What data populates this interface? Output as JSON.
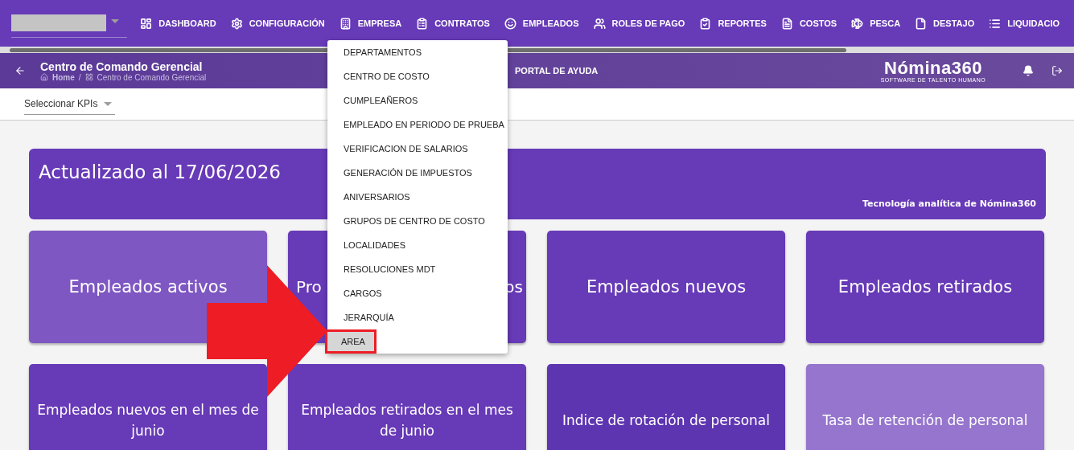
{
  "nav": {
    "items": [
      "DASHBOARD",
      "CONFIGURACIÓN",
      "EMPRESA",
      "CONTRATOS",
      "EMPLEADOS",
      "ROLES DE PAGO",
      "REPORTES",
      "COSTOS",
      "PESCA",
      "DESTAJO",
      "LIQUIDACIO"
    ]
  },
  "header": {
    "title": "Centro de Comando Gerencial",
    "breadcrumb": [
      "Home",
      "Centro de Comando Gerencial"
    ],
    "breadcrumb_separator": "/",
    "help": "PORTAL DE AYUDA",
    "logo": "Nómina360",
    "logo_tagline": "SOFTWARE DE TALENTO HUMANO"
  },
  "toolbar": {
    "kpi_select": "Seleccionar KPIs"
  },
  "banner": {
    "title": "Actualizado al 17/06/2026",
    "footer": "Tecnología analítica de Nómina360"
  },
  "cards": [
    {
      "title": "Empleados activos",
      "color": "#7e57c2"
    },
    {
      "title": "Pro",
      "title_end": "os",
      "color": "#673ab7"
    },
    {
      "title": "Empleados nuevos",
      "color": "#673ab7"
    },
    {
      "title": "Empleados retirados",
      "color": "#673ab7"
    },
    {
      "title": "Empleados nuevos en el mes de junio",
      "color": "#673ab7"
    },
    {
      "title": "Empleados retirados en el mes de junio",
      "color": "#673ab7"
    },
    {
      "title": "Indice de rotación de personal",
      "color": "#5e35b1"
    },
    {
      "title": "Tasa de retención de personal",
      "color": "#9575cd"
    }
  ],
  "menu": {
    "items": [
      {
        "label": "DEPARTAMENTOS",
        "selected": false
      },
      {
        "label": "CENTRO DE COSTO",
        "selected": false
      },
      {
        "label": "CUMPLEAÑEROS",
        "selected": false
      },
      {
        "label": "EMPLEADO EN PERIODO DE PRUEBA",
        "selected": false
      },
      {
        "label": "VERIFICACION DE SALARIOS",
        "selected": false
      },
      {
        "label": "GENERACIÓN DE IMPUESTOS",
        "selected": false
      },
      {
        "label": "ANIVERSARIOS",
        "selected": false
      },
      {
        "label": "GRUPOS DE CENTRO DE COSTO",
        "selected": false
      },
      {
        "label": "LOCALIDADES",
        "selected": false
      },
      {
        "label": "RESOLUCIONES MDT",
        "selected": false
      },
      {
        "label": "CARGOS",
        "selected": false
      },
      {
        "label": "JERARQUÍA",
        "selected": false
      },
      {
        "label": "AREA",
        "selected": true
      }
    ]
  }
}
